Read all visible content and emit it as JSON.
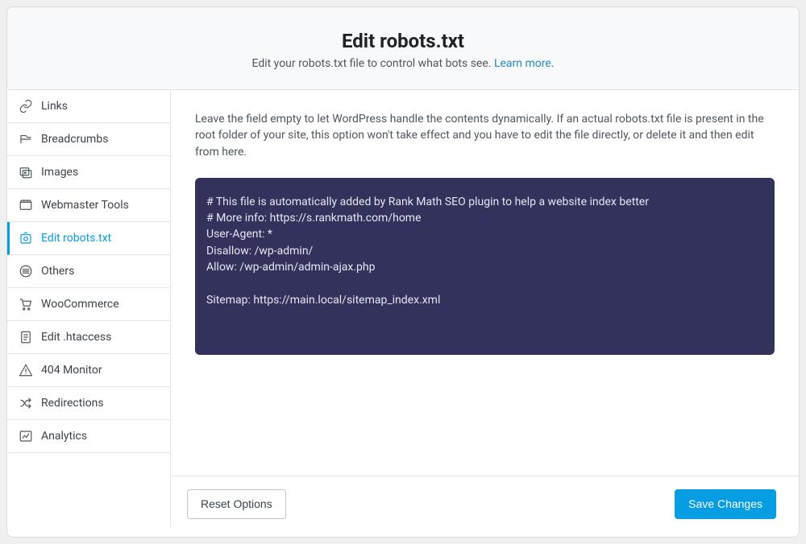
{
  "header": {
    "title": "Edit robots.txt",
    "subtitle_prefix": "Edit your robots.txt file to control what bots see. ",
    "learn_more": "Learn more",
    "subtitle_suffix": "."
  },
  "sidebar": {
    "items": [
      {
        "icon": "links",
        "label": "Links"
      },
      {
        "icon": "breadcrumbs",
        "label": "Breadcrumbs"
      },
      {
        "icon": "images",
        "label": "Images"
      },
      {
        "icon": "webmaster",
        "label": "Webmaster Tools"
      },
      {
        "icon": "robots",
        "label": "Edit robots.txt",
        "active": true
      },
      {
        "icon": "others",
        "label": "Others"
      },
      {
        "icon": "woocommerce",
        "label": "WooCommerce"
      },
      {
        "icon": "htaccess",
        "label": "Edit .htaccess"
      },
      {
        "icon": "404",
        "label": "404 Monitor"
      },
      {
        "icon": "redirections",
        "label": "Redirections"
      },
      {
        "icon": "analytics",
        "label": "Analytics"
      }
    ]
  },
  "content": {
    "helper": "Leave the field empty to let WordPress handle the contents dynamically. If an actual robots.txt file is present in the root folder of your site, this option won't take effect and you have to edit the file directly, or delete it and then edit from here.",
    "robots_text": "# This file is automatically added by Rank Math SEO plugin to help a website index better\n# More info: https://s.rankmath.com/home\nUser-Agent: *\nDisallow: /wp-admin/\nAllow: /wp-admin/admin-ajax.php\n\nSitemap: https://main.local/sitemap_index.xml"
  },
  "footer": {
    "reset": "Reset Options",
    "save": "Save Changes"
  }
}
